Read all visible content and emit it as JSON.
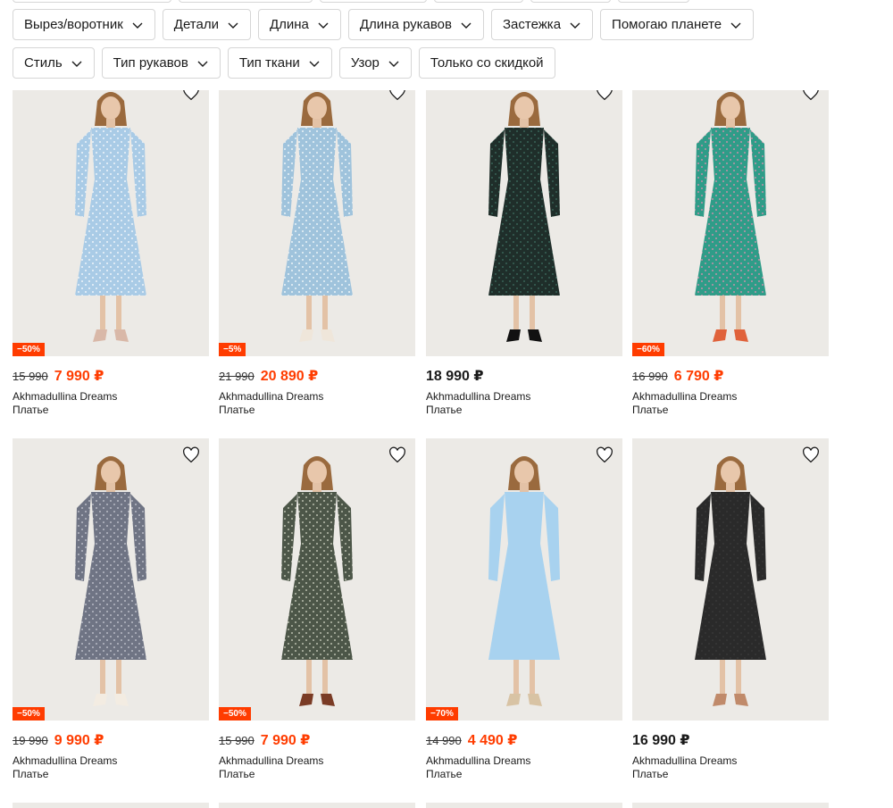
{
  "filters_row1": [
    "Вырез/воротник",
    "Детали",
    "Длина",
    "Длина рукавов",
    "Застежка",
    "Помогаю планете"
  ],
  "filters_row2": [
    {
      "label": "Стиль",
      "chevron": true
    },
    {
      "label": "Тип рукавов",
      "chevron": true
    },
    {
      "label": "Тип ткани",
      "chevron": true
    },
    {
      "label": "Узор",
      "chevron": true
    },
    {
      "label": "Только со скидкой",
      "chevron": false
    }
  ],
  "colors": {
    "accent": "#ff3c00",
    "photo_bg": "#eceae6"
  },
  "products": [
    {
      "badge": "−50%",
      "old_price": "15 990",
      "price": "7 990 ₽",
      "brand": "Akhmadullina Dreams",
      "type": "Платье",
      "dress_color": "#a9cbe6",
      "pattern": "#ffffff",
      "shoes": "#d9b8a8"
    },
    {
      "badge": "−5%",
      "old_price": "21 990",
      "price": "20 890 ₽",
      "brand": "Akhmadullina Dreams",
      "type": "Платье",
      "dress_color": "#9fc3dc",
      "pattern": "#ffffff",
      "shoes": "#efe6da"
    },
    {
      "badge": "",
      "old_price": "",
      "price": "18 990 ₽",
      "brand": "Akhmadullina Dreams",
      "type": "Платье",
      "dress_color": "#1f2e2a",
      "pattern": "#3f6f62",
      "shoes": "#111111"
    },
    {
      "badge": "−60%",
      "old_price": "16 990",
      "price": "6 790 ₽",
      "brand": "Akhmadullina Dreams",
      "type": "Платье",
      "dress_color": "#2f9c88",
      "pattern": "#e88db1",
      "shoes": "#e0623b"
    },
    {
      "badge": "−50%",
      "old_price": "19 990",
      "price": "9 990 ₽",
      "brand": "Akhmadullina Dreams",
      "type": "Платье",
      "dress_color": "#6f7484",
      "pattern": "#c9ccd6",
      "shoes": "#f3ece2"
    },
    {
      "badge": "−50%",
      "old_price": "15 990",
      "price": "7 990 ₽",
      "brand": "Akhmadullina Dreams",
      "type": "Платье",
      "dress_color": "#4c5648",
      "pattern": "#d6d8c8",
      "shoes": "#7a3b25"
    },
    {
      "badge": "−70%",
      "old_price": "14 990",
      "price": "4 490 ₽",
      "brand": "Akhmadullina Dreams",
      "type": "Платье",
      "dress_color": "#a8d2ef",
      "pattern": "#a8d2ef",
      "shoes": "#d8c3a4"
    },
    {
      "badge": "",
      "old_price": "",
      "price": "16 990 ₽",
      "brand": "Akhmadullina Dreams",
      "type": "Платье",
      "dress_color": "#2a2a2a",
      "pattern": "#3a3a3a",
      "shoes": "#c08a6a"
    }
  ]
}
